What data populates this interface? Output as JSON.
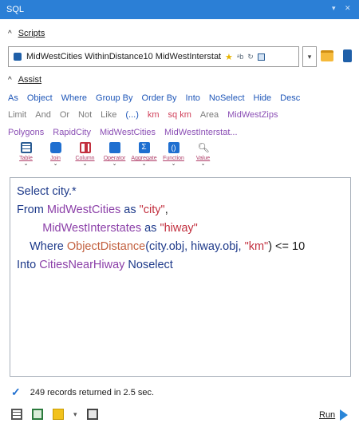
{
  "window": {
    "title": "SQL"
  },
  "scripts": {
    "header_label": "Scripts",
    "selected_script": "MidWestCities WithinDistance10 MidWestInterstat"
  },
  "assist": {
    "header_label": "Assist",
    "row1": [
      "As",
      "Object",
      "Where",
      "Group By",
      "Order By",
      "Into",
      "NoSelect",
      "Hide",
      "Desc"
    ],
    "row2_plain": [
      "Limit",
      "And",
      "Or",
      "Not",
      "Like",
      "(...)"
    ],
    "row2_red": [
      "km",
      "sq km"
    ],
    "row2_gray": [
      "Area"
    ],
    "row2_purple": [
      "MidWestZips"
    ],
    "row3": [
      "Polygons",
      "RapidCity",
      "MidWestCities",
      "MidWestInterstat..."
    ],
    "tools": [
      {
        "label": "Table",
        "icon": "table-icon",
        "color": "#2b5c93"
      },
      {
        "label": "Join",
        "icon": "join-icon",
        "color": "#1f6fd0"
      },
      {
        "label": "Column",
        "icon": "column-icon",
        "color": "#c2303f"
      },
      {
        "label": "Operator",
        "icon": "operator-icon",
        "color": "#1f6fd0"
      },
      {
        "label": "Aggregate",
        "icon": "aggregate-icon",
        "color": "#1f6fd0"
      },
      {
        "label": "Function",
        "icon": "function-icon",
        "color": "#1f6fd0"
      },
      {
        "label": "Value",
        "icon": "value-icon",
        "color": "#555555"
      }
    ]
  },
  "query": {
    "line1": {
      "kw": "Select",
      "rest": " city.*"
    },
    "line2": {
      "kw": "From",
      "table": " MidWestCities",
      "as": " as ",
      "alias": "\"city\"",
      "comma": ","
    },
    "line3": {
      "indent": "        ",
      "table": "MidWestInterstates",
      "as": " as ",
      "alias": "\"hiway\""
    },
    "line4": {
      "indent": "    ",
      "kw": "Where",
      "func": " ObjectDistance",
      "args": "(city.obj, hiway.obj, ",
      "unit": "\"km\"",
      "tail": ") <= 10"
    },
    "line5": {
      "kw": "Into",
      "table": " CitiesNearHiway",
      "kw2": " Noselect"
    }
  },
  "status": {
    "message": "249 records returned in 2.5 sec."
  },
  "run": {
    "label": "Run"
  }
}
